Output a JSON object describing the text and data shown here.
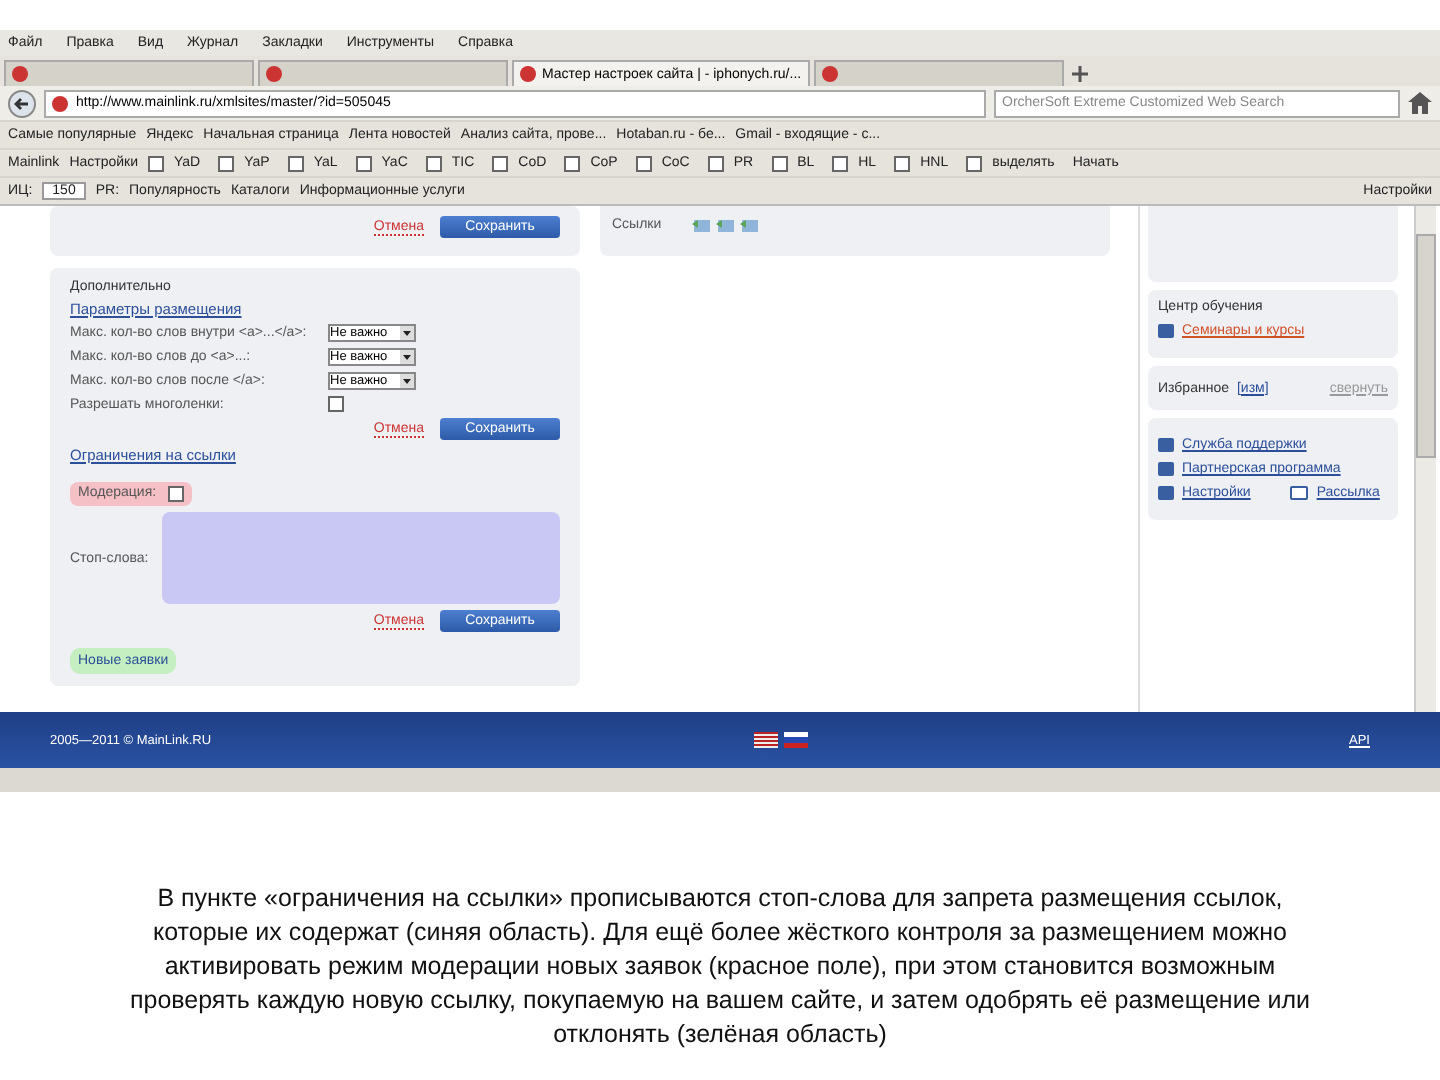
{
  "menu": [
    "Файл",
    "Правка",
    "Вид",
    "Журнал",
    "Закладки",
    "Инструменты",
    "Справка"
  ],
  "tabs": [
    {
      "selected": false
    },
    {
      "selected": false
    },
    {
      "title": "Мастер настроек сайта | - iphonych.ru/...",
      "selected": true
    },
    {
      "selected": false
    }
  ],
  "address": {
    "url": "http://www.mainlink.ru/xmlsites/master/?id=505045"
  },
  "search": {
    "placeholder": "OrcherSoft Extreme Customized Web Search"
  },
  "bookmarks": [
    "Самые популярные",
    "Яндекс",
    "Начальная страница",
    "Лента новостей",
    "Анализ сайта, прове...",
    "Hotaban.ru - бе...",
    "Gmail - входящие - c..."
  ],
  "mainlink_bar": {
    "brand": "Mainlink",
    "settings": "Настройки",
    "options": [
      {
        "label": "YaD",
        "checked": false
      },
      {
        "label": "YaP",
        "checked": false
      },
      {
        "label": "YaL",
        "checked": false
      },
      {
        "label": "YaC",
        "checked": false
      },
      {
        "label": "TIC",
        "checked": false
      },
      {
        "label": "CoD",
        "checked": false
      },
      {
        "label": "CoP",
        "checked": false
      },
      {
        "label": "CoC",
        "checked": false
      },
      {
        "label": "PR",
        "checked": false
      },
      {
        "label": "BL",
        "checked": false
      },
      {
        "label": "HL",
        "checked": false
      },
      {
        "label": "HNL",
        "checked": false
      },
      {
        "label": "выделять",
        "checked": false
      }
    ],
    "start": "Начать"
  },
  "yandex_bar": {
    "tic_label": "ИЦ:",
    "tic_value": "150",
    "pr_label": "PR:",
    "menus": [
      "Популярность",
      "Каталоги",
      "Информационные услуги"
    ],
    "settings": "Настройки"
  },
  "left": {
    "cancel": "Отмена",
    "save": "Сохранить",
    "extra": {
      "heading": "Дополнительно",
      "link": "Параметры размещения",
      "rows": [
        {
          "kind": "select",
          "label": "Макс. кол-во слов внутри <a>...</a>:",
          "value": "Не важно"
        },
        {
          "kind": "select",
          "label": "Макс. кол-во слов до <a>...:",
          "value": "Не важно"
        },
        {
          "kind": "select",
          "label": "Макс. кол-во слов после </a>:",
          "value": "Не важно"
        },
        {
          "kind": "checkbox",
          "label": "Разрешать многоленки:",
          "checked": false
        }
      ],
      "cancel": "Отмена",
      "save": "Сохранить"
    },
    "limits": {
      "link": "Ограничения на ссылки",
      "moderation": {
        "label": "Модерация:",
        "checked": false
      },
      "stopwords_label": "Стоп-слова:",
      "cancel": "Отмена",
      "save": "Сохранить"
    },
    "new_requests": "Новые заявки"
  },
  "middle": {
    "links_label": "Ссылки"
  },
  "right": {
    "training": {
      "heading": "Центр обучения",
      "link": "Семинары и курсы"
    },
    "favorites": {
      "heading": "Избранное",
      "edit": "[изм]",
      "collapse": "свернуть"
    },
    "links": [
      "Служба поддержки",
      "Партнерская программа",
      "Настройки",
      "Рассылка"
    ]
  },
  "footer": {
    "copyright": "2005—2011 © MainLink.RU",
    "api": "API"
  },
  "caption": "В пункте «ограничения на ссылки» прописываются стоп-слова для запрета размещения ссылок, которые их содержат (синяя область). Для ещё более жёсткого контроля за размещением можно активировать режим модерации новых заявок (красное поле), при этом становится возможным проверять каждую новую ссылку, покупаемую на вашем сайте, и затем одобрять её размещение или отклонять (зелёная область)"
}
